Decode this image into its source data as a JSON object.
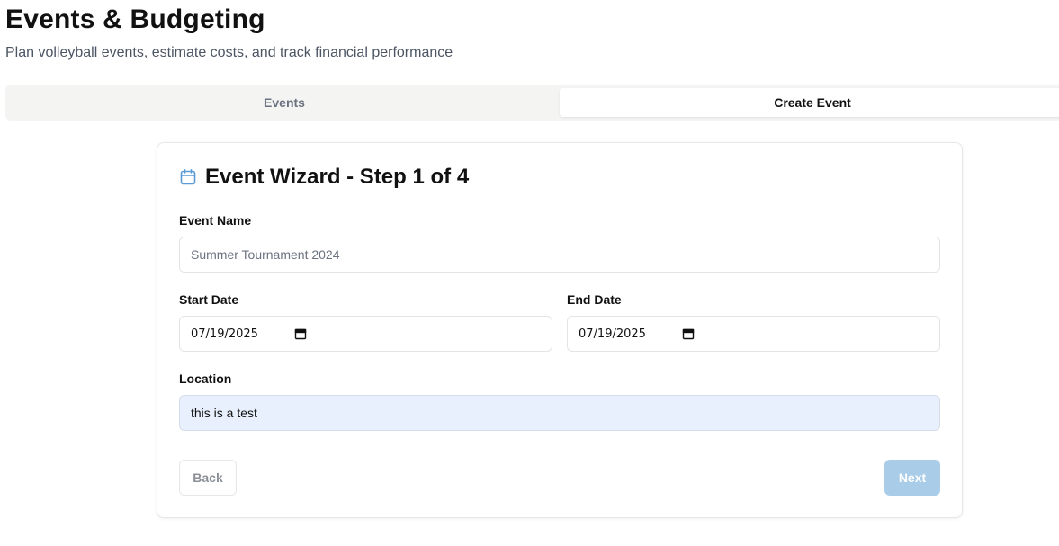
{
  "header": {
    "title": "Events & Budgeting",
    "subtitle": "Plan volleyball events, estimate costs, and track financial performance"
  },
  "tabs": [
    {
      "label": "Events",
      "active": false
    },
    {
      "label": "Create Event",
      "active": true
    }
  ],
  "wizard": {
    "icon": "calendar-icon",
    "title": "Event Wizard - Step 1 of 4",
    "event_name": {
      "label": "Event Name",
      "placeholder": "Summer Tournament 2024",
      "value": ""
    },
    "start_date": {
      "label": "Start Date",
      "value": "07/19/2025"
    },
    "end_date": {
      "label": "End Date",
      "value": "07/19/2025"
    },
    "location": {
      "label": "Location",
      "value": "this is a test"
    },
    "back_label": "Back",
    "next_label": "Next"
  },
  "colors": {
    "accent": "#5b9bd5",
    "next_disabled_bg": "#a9cde8",
    "autofill_bg": "#e8f0fd"
  }
}
